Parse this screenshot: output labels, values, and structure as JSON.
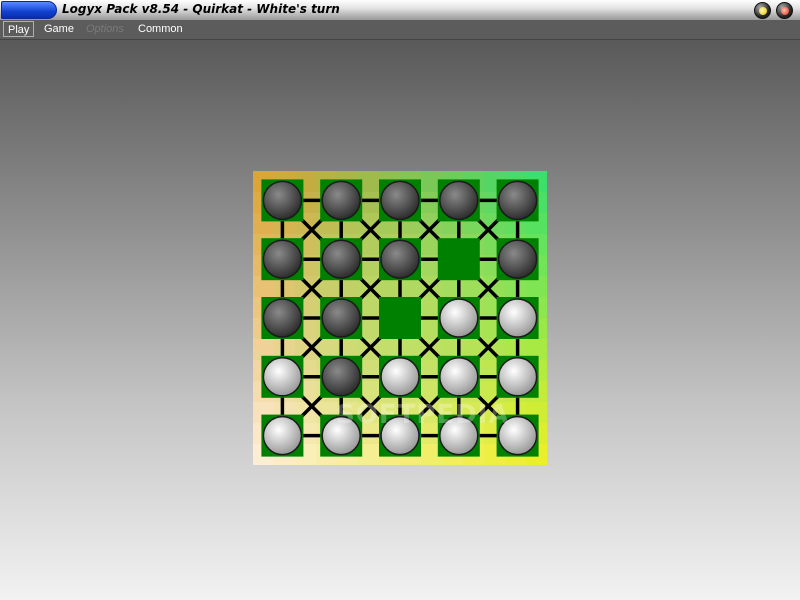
{
  "window": {
    "title": "Logyx Pack v8.54 - Quirkat - White's turn"
  },
  "menu": {
    "items": [
      {
        "label": "Play",
        "state": "active"
      },
      {
        "label": "Game",
        "state": "normal"
      },
      {
        "label": "Options",
        "state": "disabled"
      },
      {
        "label": "Common",
        "state": "normal"
      }
    ]
  },
  "board": {
    "size": 5,
    "pieces": [
      [
        "black",
        "black",
        "black",
        "black",
        "black"
      ],
      [
        "black",
        "black",
        "black",
        "empty",
        "black"
      ],
      [
        "black",
        "black",
        "empty",
        "white",
        "white"
      ],
      [
        "white",
        "black",
        "white",
        "white",
        "white"
      ],
      [
        "white",
        "white",
        "white",
        "white",
        "white"
      ]
    ],
    "colors": {
      "line": "#000000",
      "empty_square": "#008000",
      "piece_black": "#5a5a5a",
      "piece_white": "#dcdcdc",
      "top_left": "#e0a030",
      "top_right": "#30e070",
      "bottom_left": "#fff0e0",
      "bottom_right": "#f0f020",
      "mid_center": "#b0e060"
    }
  },
  "watermark": "SOFTPEDIA"
}
